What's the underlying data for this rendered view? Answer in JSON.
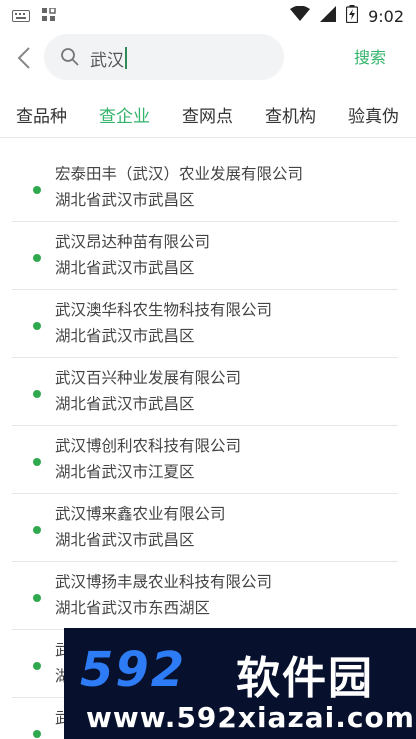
{
  "status_bar": {
    "time": "9:02"
  },
  "search": {
    "query": "武汉",
    "button_label": "搜索"
  },
  "tabs": [
    {
      "label": "查品种"
    },
    {
      "label": "查企业"
    },
    {
      "label": "查网点"
    },
    {
      "label": "查机构"
    },
    {
      "label": "验真伪"
    }
  ],
  "active_tab": "查企业",
  "results": [
    {
      "name": "宏泰田丰（武汉）农业发展有限公司",
      "address": "湖北省武汉市武昌区"
    },
    {
      "name": "武汉昂达种苗有限公司",
      "address": "湖北省武汉市武昌区"
    },
    {
      "name": "武汉澳华科农生物科技有限公司",
      "address": "湖北省武汉市武昌区"
    },
    {
      "name": "武汉百兴种业发展有限公司",
      "address": "湖北省武汉市武昌区"
    },
    {
      "name": "武汉博创利农科技有限公司",
      "address": "湖北省武汉市江夏区"
    },
    {
      "name": "武汉博来鑫农业有限公司",
      "address": "湖北省武汉市武昌区"
    },
    {
      "name": "武汉博扬丰晟农业科技有限公司",
      "address": "湖北省武汉市东西湖区"
    },
    {
      "name": "武",
      "address": "湖"
    },
    {
      "name": "武",
      "address": ""
    }
  ],
  "watermark": {
    "logo": "592",
    "brand": "软件园",
    "url": "www.592xiazai.com"
  },
  "colors": {
    "accent": "#33b36b",
    "dot": "#2fa84f",
    "watermark_bg": "#07102c",
    "watermark_logo": "#2d7cf6"
  }
}
